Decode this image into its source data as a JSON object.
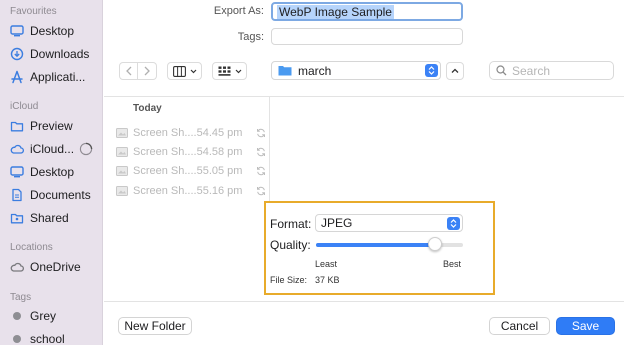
{
  "sidebar": {
    "favourites_heading": "Favourites",
    "favourites": [
      {
        "label": "Desktop",
        "icon": "desktop-icon"
      },
      {
        "label": "Downloads",
        "icon": "downloads-icon"
      },
      {
        "label": "Applicati...",
        "icon": "applications-icon"
      }
    ],
    "icloud_heading": "iCloud",
    "icloud": [
      {
        "label": "Preview",
        "icon": "folder-icon"
      },
      {
        "label": "iCloud...",
        "icon": "icloud-icon"
      },
      {
        "label": "Desktop",
        "icon": "desktop-icon"
      },
      {
        "label": "Documents",
        "icon": "documents-icon"
      },
      {
        "label": "Shared",
        "icon": "shared-folder-icon"
      }
    ],
    "locations_heading": "Locations",
    "locations": [
      {
        "label": "OneDrive",
        "icon": "cloud-icon"
      }
    ],
    "tags_heading": "Tags",
    "tags": [
      {
        "label": "Grey",
        "color": "#8e8e93"
      },
      {
        "label": "school",
        "color": "#8e8e93"
      }
    ]
  },
  "export": {
    "label": "Export As:",
    "value": "WebP Image Sample",
    "tags_label": "Tags:"
  },
  "toolbar": {
    "location": "march",
    "search_placeholder": "Search"
  },
  "files": {
    "group_label": "Today",
    "items": [
      {
        "name": "Screen Sh....54.45 pm"
      },
      {
        "name": "Screen Sh....54.58 pm"
      },
      {
        "name": "Screen Sh....55.05 pm"
      },
      {
        "name": "Screen Sh....55.16 pm"
      }
    ]
  },
  "format_panel": {
    "format_label": "Format:",
    "format_value": "JPEG",
    "quality_label": "Quality:",
    "quality_fraction": 0.81,
    "least_label": "Least",
    "best_label": "Best",
    "file_size_label": "File Size:",
    "file_size_value": "37 KB",
    "highlight_color": "#e8ab2b"
  },
  "buttons": {
    "new_folder": "New Folder",
    "cancel": "Cancel",
    "save": "Save"
  },
  "colors": {
    "accent": "#2f7cf6",
    "sidebar_bg": "#e8e1eb",
    "sidebar_icon": "#3b7de0"
  }
}
